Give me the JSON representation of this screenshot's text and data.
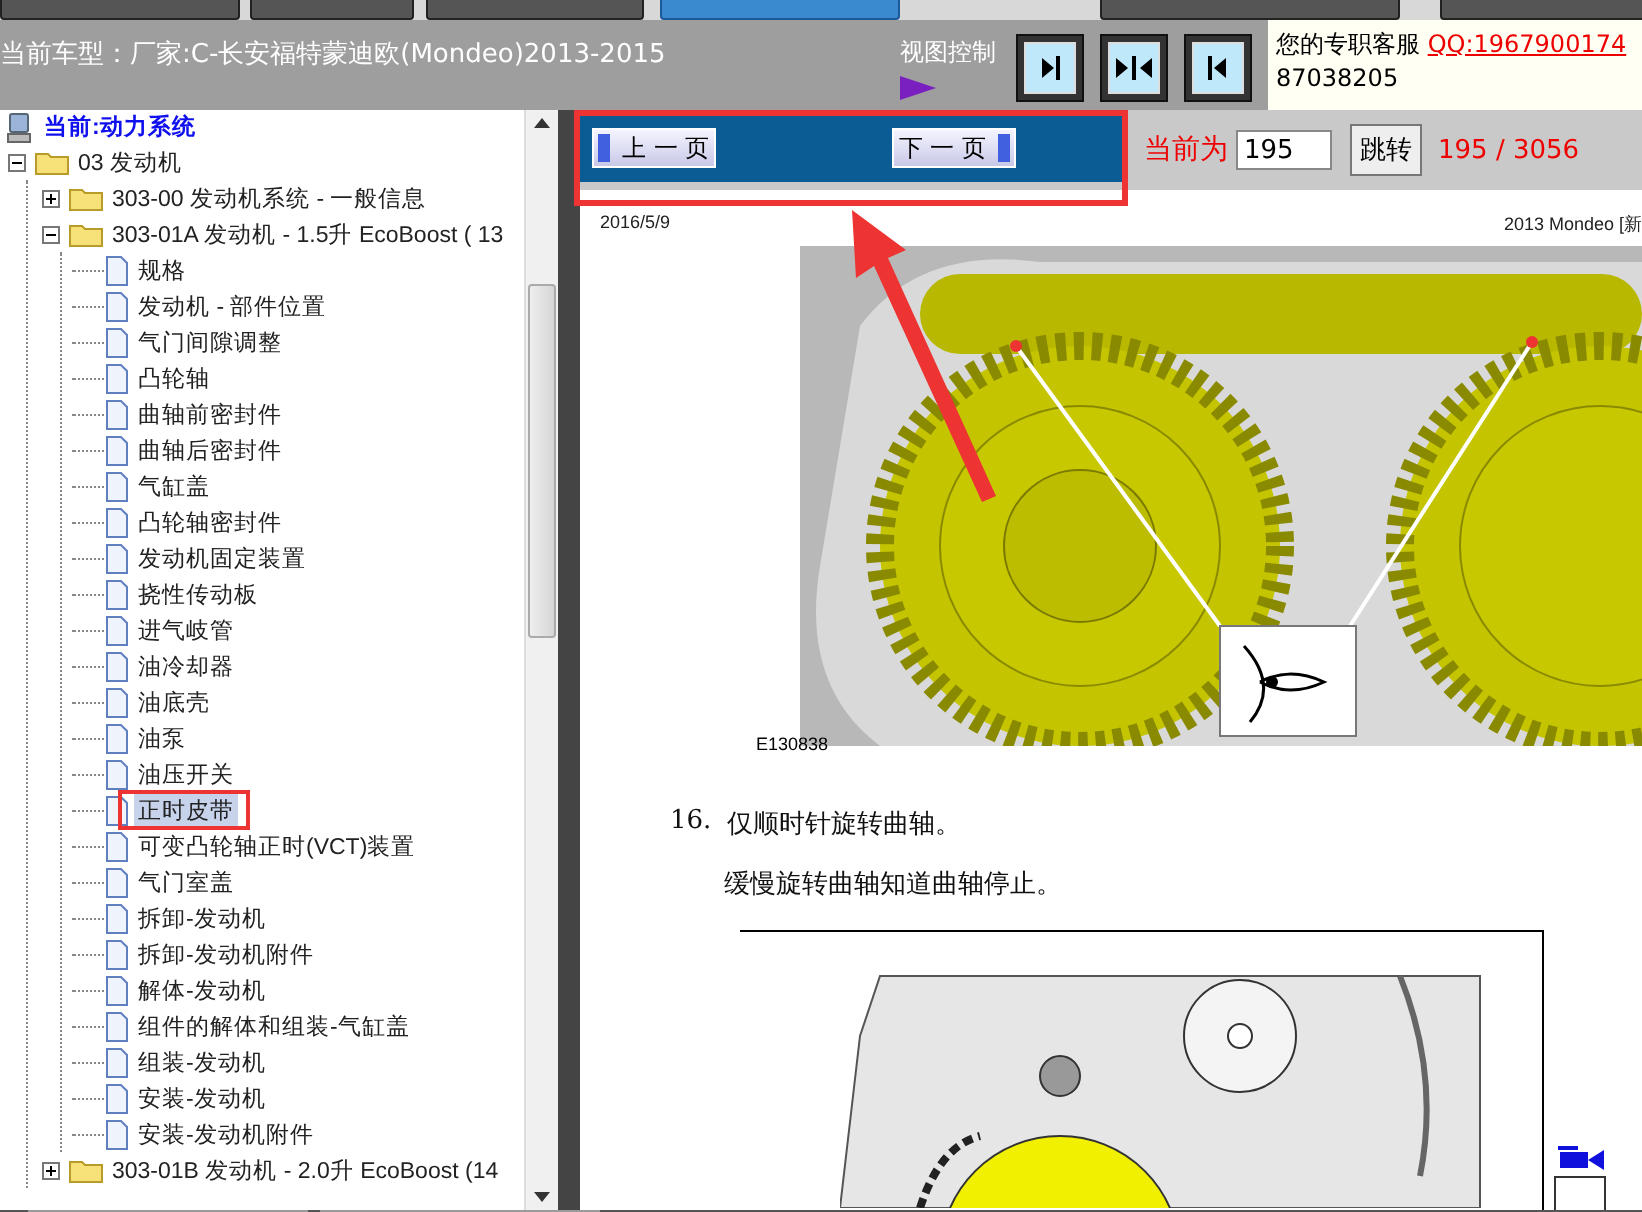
{
  "header": {
    "vehicle": "当前车型：厂家:C-长安福特蒙迪欧(Mondeo)2013-2015",
    "view_control_label": "视图控制",
    "support_label": "您的专职客服",
    "support_qq": "QQ:1967900174",
    "support_phone": "87038205"
  },
  "tree": {
    "label": "当前:动力系统",
    "kind": "root",
    "selected": false,
    "children": [
      {
        "label": "03 发动机",
        "kind": "folder",
        "expanded": true,
        "selected": false,
        "children": [
          {
            "label": "303-00 发动机系统 - 一般信息",
            "kind": "folder",
            "expanded": false,
            "selected": false
          },
          {
            "label": "303-01A 发动机 - 1.5升 EcoBoost ( 13",
            "kind": "folder",
            "expanded": true,
            "selected": false,
            "children": [
              {
                "label": "规格",
                "kind": "page",
                "selected": false
              },
              {
                "label": "发动机 - 部件位置",
                "kind": "page",
                "selected": false
              },
              {
                "label": "气门间隙调整",
                "kind": "page",
                "selected": false
              },
              {
                "label": "凸轮轴",
                "kind": "page",
                "selected": false
              },
              {
                "label": "曲轴前密封件",
                "kind": "page",
                "selected": false
              },
              {
                "label": "曲轴后密封件",
                "kind": "page",
                "selected": false
              },
              {
                "label": "气缸盖",
                "kind": "page",
                "selected": false
              },
              {
                "label": "凸轮轴密封件",
                "kind": "page",
                "selected": false
              },
              {
                "label": "发动机固定装置",
                "kind": "page",
                "selected": false
              },
              {
                "label": "挠性传动板",
                "kind": "page",
                "selected": false
              },
              {
                "label": "进气岐管",
                "kind": "page",
                "selected": false
              },
              {
                "label": "油冷却器",
                "kind": "page",
                "selected": false
              },
              {
                "label": "油底壳",
                "kind": "page",
                "selected": false
              },
              {
                "label": "油泵",
                "kind": "page",
                "selected": false
              },
              {
                "label": "油压开关",
                "kind": "page",
                "selected": false
              },
              {
                "label": "正时皮带",
                "kind": "page",
                "selected": true
              },
              {
                "label": "可变凸轮轴正时(VCT)装置",
                "kind": "page",
                "selected": false
              },
              {
                "label": "气门室盖",
                "kind": "page",
                "selected": false
              },
              {
                "label": "拆卸-发动机",
                "kind": "page",
                "selected": false
              },
              {
                "label": "拆卸-发动机附件",
                "kind": "page",
                "selected": false
              },
              {
                "label": "解体-发动机",
                "kind": "page",
                "selected": false
              },
              {
                "label": "组件的解体和组装-气缸盖",
                "kind": "page",
                "selected": false
              },
              {
                "label": "组装-发动机",
                "kind": "page",
                "selected": false
              },
              {
                "label": "安装-发动机",
                "kind": "page",
                "selected": false
              },
              {
                "label": "安装-发动机附件",
                "kind": "page",
                "selected": false
              }
            ]
          },
          {
            "label": "303-01B 发动机 - 2.0升 EcoBoost (14",
            "kind": "folder",
            "expanded": false,
            "selected": false
          }
        ]
      }
    ]
  },
  "pager": {
    "prev": "上 一 页",
    "next": "下 一 页",
    "current_label": "当前为",
    "current_value": "195",
    "go": "跳转",
    "position": "195 / 3056"
  },
  "document": {
    "date": "2016/5/9",
    "header_title": "2013 Mondeo [新",
    "figure_id": "E130838",
    "step_number": "16.",
    "step_text": "仅顺时针旋转曲轴。",
    "step_note": "缓慢旋转曲轴知道曲轴停止。"
  }
}
